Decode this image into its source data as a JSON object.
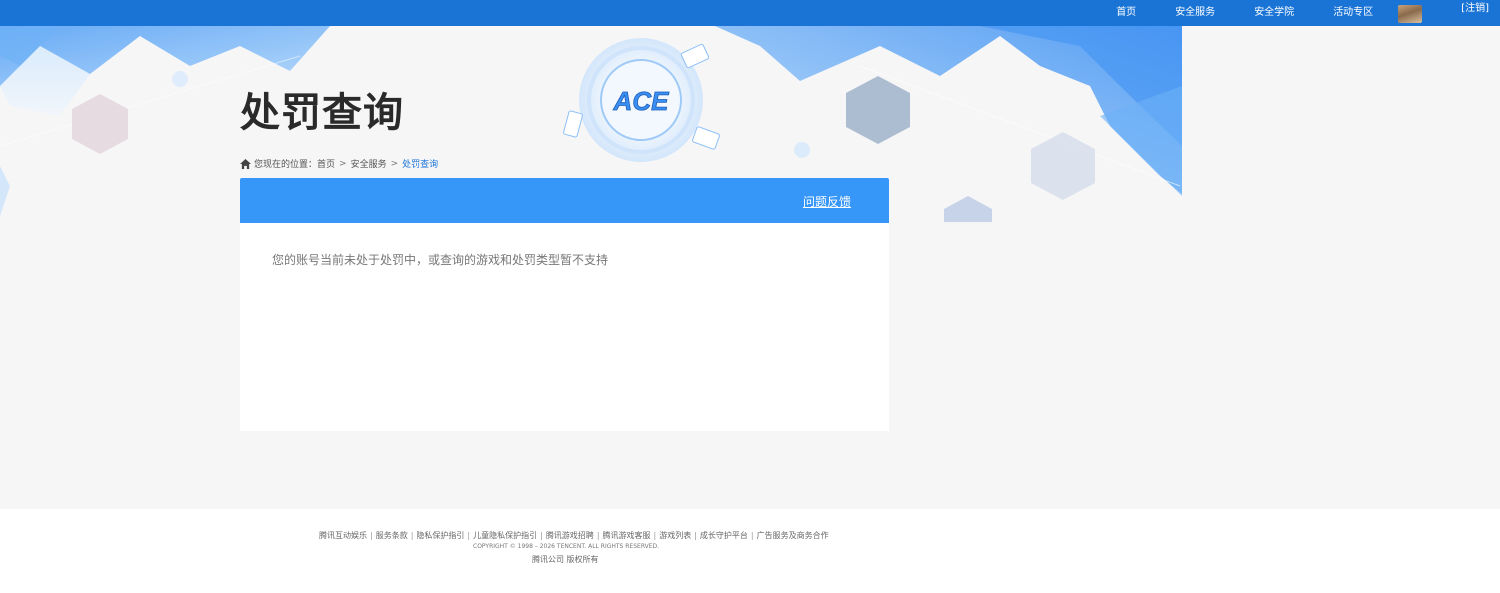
{
  "topnav": {
    "items": [
      "首页",
      "安全服务",
      "安全学院",
      "活动专区"
    ],
    "logout": "[注销]"
  },
  "page": {
    "title": "处罚查询"
  },
  "breadcrumb": {
    "prefix": "您现在的位置：",
    "items": [
      "首页",
      "安全服务"
    ],
    "current": "处罚查询",
    "separator": ">"
  },
  "panel": {
    "feedback": "问题反馈",
    "message": "您的账号当前未处于处罚中，或查询的游戏和处罚类型暂不支持"
  },
  "footer": {
    "links": [
      "腾讯互动娱乐",
      "服务条款",
      "隐私保护指引",
      "儿童隐私保护指引",
      "腾讯游戏招聘",
      "腾讯游戏客服",
      "游戏列表",
      "成长守护平台",
      "广告服务及商务合作"
    ],
    "copyright": "COPYRIGHT © 1998 – 2026 TENCENT. ALL RIGHTS RESERVED.",
    "company": "腾讯公司 版权所有"
  },
  "logo": {
    "text": "ACE"
  },
  "colors": {
    "topbar": "#1a74d6",
    "panel_header": "#3797f8",
    "breadcrumb_current": "#1a74d6",
    "background": "#f6f6f7"
  },
  "icons": {
    "breadcrumb": "home-icon",
    "account": "avatar"
  }
}
